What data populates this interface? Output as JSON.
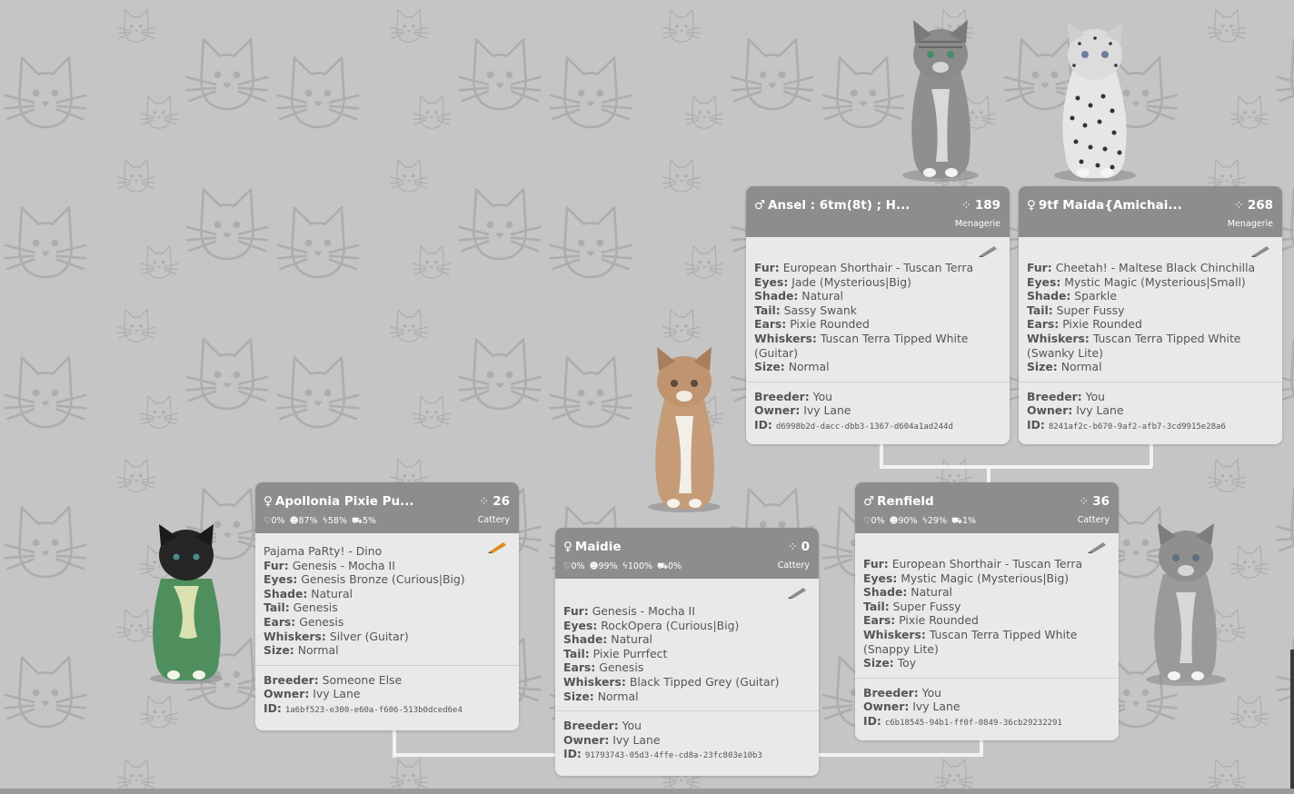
{
  "colors": {
    "background": "#c5c5c5",
    "card_header": "#8d8d8d",
    "card_body": "#e9e9e9",
    "connector": "#f2f2f2",
    "pencil_orange": "#e08a1e",
    "pencil_grey": "#8c8c8c"
  },
  "cards": {
    "ansel": {
      "gender": "♂",
      "name": "Ansel : 6tm(8t) ; H...",
      "score": "189",
      "place": "Menagerie",
      "rows": [
        {
          "label": "Fur:",
          "value": "European Shorthair - Tuscan Terra"
        },
        {
          "label": "Eyes:",
          "value": "Jade (Mysterious|Big)"
        },
        {
          "label": "Shade:",
          "value": "Natural"
        },
        {
          "label": "Tail:",
          "value": "Sassy Swank"
        },
        {
          "label": "Ears:",
          "value": "Pixie Rounded"
        },
        {
          "label": "Whiskers:",
          "value": "Tuscan Terra Tipped White (Guitar)"
        },
        {
          "label": "Size:",
          "value": "Normal"
        }
      ],
      "breeder_label": "Breeder:",
      "breeder": "You",
      "owner_label": "Owner:",
      "owner": "Ivy Lane",
      "id_label": "ID:",
      "id": "d6998b2d-dacc-dbb3-1367-d604a1ad244d",
      "edit_icon": "pencil-icon"
    },
    "maida": {
      "gender": "♀",
      "name": "9tf Maida{Amichai...",
      "score": "268",
      "place": "Menagerie",
      "rows": [
        {
          "label": "Fur:",
          "value": "Cheetah! - Maltese Black Chinchilla"
        },
        {
          "label": "Eyes:",
          "value": "Mystic Magic (Mysterious|Small)"
        },
        {
          "label": "Shade:",
          "value": "Sparkle"
        },
        {
          "label": "Tail:",
          "value": "Super Fussy"
        },
        {
          "label": "Ears:",
          "value": "Pixie Rounded"
        },
        {
          "label": "Whiskers:",
          "value": "Tuscan Terra Tipped White (Swanky Lite)"
        },
        {
          "label": "Size:",
          "value": "Normal"
        }
      ],
      "breeder_label": "Breeder:",
      "breeder": "You",
      "owner_label": "Owner:",
      "owner": "Ivy Lane",
      "id_label": "ID:",
      "id": "8241af2c-b670-9af2-afb7-3cd9915e28a6",
      "edit_icon": "pencil-icon"
    },
    "apollonia": {
      "gender": "♀",
      "name": "Apollonia Pixie Pu...",
      "score": "26",
      "place": "Cattery",
      "stats": [
        "♡0%",
        "☻87%",
        "ϟ58%",
        "⛟5%"
      ],
      "outfit": "Pajama PaRty! - Dino",
      "rows": [
        {
          "label": "Fur:",
          "value": "Genesis - Mocha II"
        },
        {
          "label": "Eyes:",
          "value": "Genesis Bronze (Curious|Big)"
        },
        {
          "label": "Shade:",
          "value": "Natural"
        },
        {
          "label": "Tail:",
          "value": "Genesis"
        },
        {
          "label": "Ears:",
          "value": "Genesis"
        },
        {
          "label": "Whiskers:",
          "value": "Silver (Guitar)"
        },
        {
          "label": "Size:",
          "value": "Normal"
        }
      ],
      "breeder_label": "Breeder:",
      "breeder": "Someone Else",
      "owner_label": "Owner:",
      "owner": "Ivy Lane",
      "id_label": "ID:",
      "id": "1a6bf523-e300-e60a-f606-513b0dced6e4",
      "edit_icon": "pencil-icon"
    },
    "maidie": {
      "gender": "♀",
      "name": "Maidie",
      "score": "0",
      "place": "Cattery",
      "stats": [
        "♡0%",
        "☻99%",
        "ϟ100%",
        "⛟0%"
      ],
      "rows": [
        {
          "label": "Fur:",
          "value": "Genesis - Mocha II"
        },
        {
          "label": "Eyes:",
          "value": "RockOpera (Curious|Big)"
        },
        {
          "label": "Shade:",
          "value": "Natural"
        },
        {
          "label": "Tail:",
          "value": "Pixie Purrfect"
        },
        {
          "label": "Ears:",
          "value": "Genesis"
        },
        {
          "label": "Whiskers:",
          "value": "Black Tipped Grey (Guitar)"
        },
        {
          "label": "Size:",
          "value": "Normal"
        }
      ],
      "breeder_label": "Breeder:",
      "breeder": "You",
      "owner_label": "Owner:",
      "owner": "Ivy Lane",
      "id_label": "ID:",
      "id": "91793743-05d3-4ffe-cd8a-23fc803e10b3",
      "edit_icon": "pencil-icon"
    },
    "renfield": {
      "gender": "♂",
      "name": "Renfield",
      "score": "36",
      "place": "Cattery",
      "stats": [
        "♡0%",
        "☻90%",
        "ϟ29%",
        "⛟1%"
      ],
      "rows": [
        {
          "label": "Fur:",
          "value": "European Shorthair - Tuscan Terra"
        },
        {
          "label": "Eyes:",
          "value": "Mystic Magic (Mysterious|Big)"
        },
        {
          "label": "Shade:",
          "value": "Natural"
        },
        {
          "label": "Tail:",
          "value": "Super Fussy"
        },
        {
          "label": "Ears:",
          "value": "Pixie Rounded"
        },
        {
          "label": "Whiskers:",
          "value": "Tuscan Terra Tipped White (Snappy Lite)"
        },
        {
          "label": "Size:",
          "value": "Toy"
        }
      ],
      "breeder_label": "Breeder:",
      "breeder": "You",
      "owner_label": "Owner:",
      "owner": "Ivy Lane",
      "id_label": "ID:",
      "id": "c6b18545-94b1-ff0f-0849-36cb29232291",
      "edit_icon": "pencil-icon"
    }
  },
  "score_icon": "spinner-icon"
}
